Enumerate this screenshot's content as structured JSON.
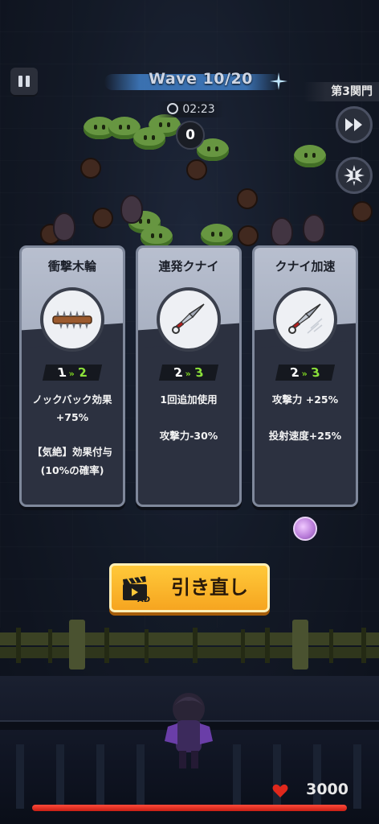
{
  "hud": {
    "wave_label": "Wave 10/20",
    "stage_label": "第3関門",
    "timer": "02:23",
    "combo_count": "0",
    "fast_forward_icon": "fast-forward-icon",
    "skill_icon": "burst-skill-icon"
  },
  "cards": [
    {
      "name": "衝撃木輪",
      "icon": "spiked-wooden-ring-icon",
      "level_from": "1",
      "level_to": "2",
      "desc": [
        "ノックバック効果",
        "+75%",
        "",
        "【気絶】効果付与",
        "(10%の確率)"
      ]
    },
    {
      "name": "連発クナイ",
      "icon": "kunai-icon",
      "level_from": "2",
      "level_to": "3",
      "desc": [
        "1回追加使用",
        "",
        "攻撃力-30%"
      ]
    },
    {
      "name": "クナイ加速",
      "icon": "kunai-icon",
      "level_from": "2",
      "level_to": "3",
      "desc": [
        "攻撃力 +25%",
        "",
        "投射速度+25%"
      ]
    }
  ],
  "level_arrow": "»",
  "reroll": {
    "label": "引き直し",
    "ad_badge": "AD"
  },
  "player": {
    "hp": "3000",
    "hp_fraction": 1.0
  },
  "colors": {
    "accent_green": "#8be03a",
    "button_orange": "#f6a520",
    "hp_red": "#e0281c"
  }
}
